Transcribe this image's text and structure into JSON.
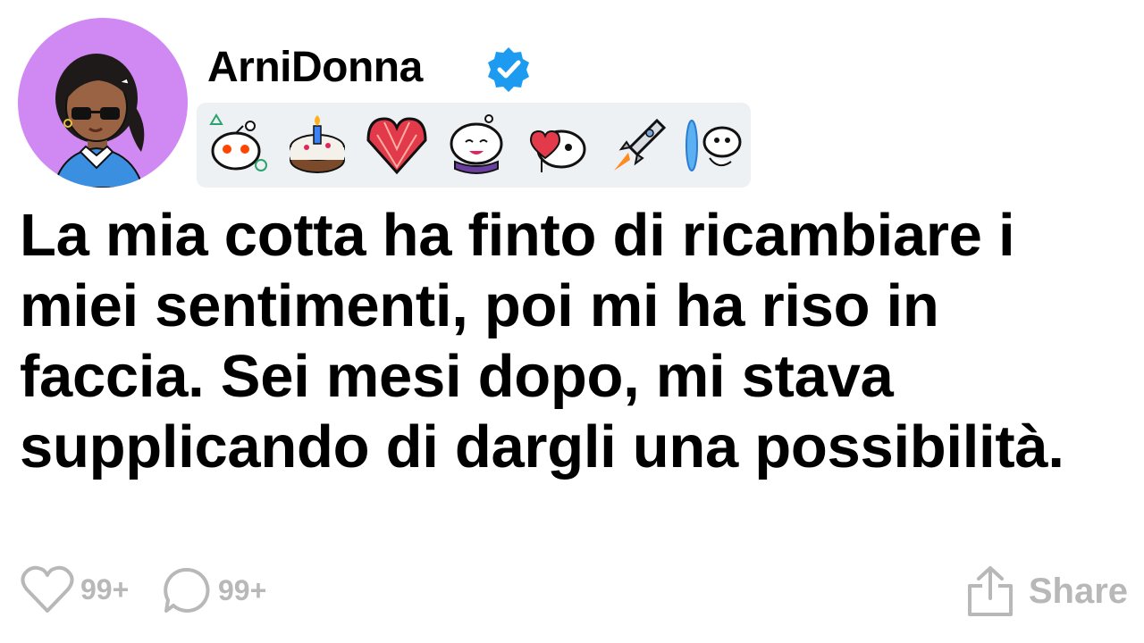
{
  "post": {
    "author": "ArniDonna",
    "verified": true,
    "badges": [
      {
        "icon": "snoo-shapes-badge-icon"
      },
      {
        "icon": "birthday-cake-badge-icon"
      },
      {
        "icon": "crystal-heart-badge-icon"
      },
      {
        "icon": "snoo-scarf-badge-icon"
      },
      {
        "icon": "snoo-heart-balloon-badge-icon"
      },
      {
        "icon": "rocket-badge-icon"
      },
      {
        "icon": "snoo-portal-badge-icon"
      }
    ],
    "text": "La mia cotta ha finto di ricambiare i miei sentimenti, poi mi ha riso in faccia. Sei mesi dopo, mi stava supplicando di dargli una possibilità."
  },
  "actions": {
    "likes": "99+",
    "comments": "99+",
    "share_label": "Share"
  },
  "colors": {
    "avatar_bg": "#d089f3",
    "verified": "#1d9bf0",
    "action_gray": "#b8b8b8",
    "badge_bar_bg": "#eef1f4"
  }
}
